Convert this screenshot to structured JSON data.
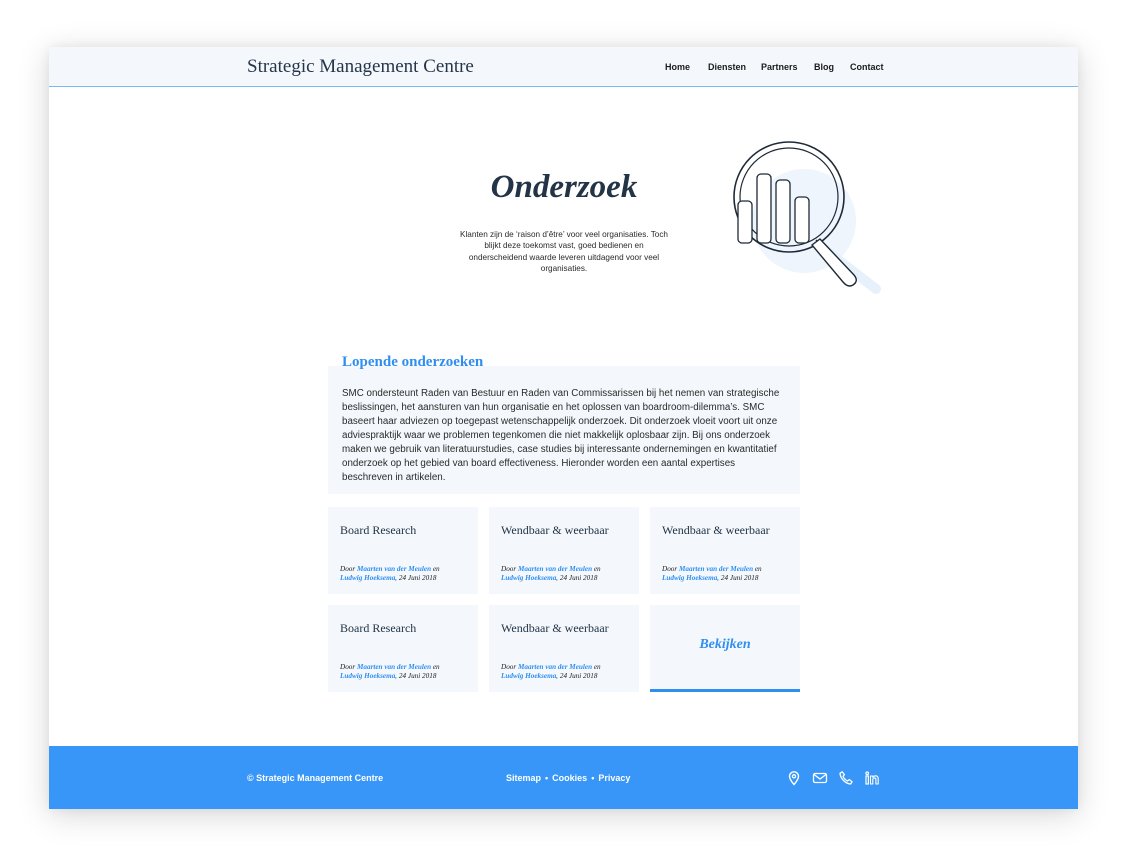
{
  "header": {
    "logo": "Strategic Management Centre",
    "nav": [
      "Home",
      "Diensten",
      "Partners",
      "Blog",
      "Contact"
    ]
  },
  "hero": {
    "title": "Onderzoek",
    "text": "Klanten zijn de ‘raison d’être’ voor veel organisaties. Toch blijkt deze toekomst vast, goed bedienen en onderscheidend waarde leveren uitdagend voor veel organisaties."
  },
  "intro": {
    "heading": "Lopende onderzoeken",
    "text": "SMC ondersteunt Raden van Bestuur en Raden van Commissarissen bij het nemen van strategische beslissingen, het aansturen van hun organisatie en het oplossen van boardroom-dilemma’s. SMC baseert haar adviezen op toegepast wetenschappelijk onderzoek. Dit onderzoek vloeit voort uit onze adviespraktijk waar we problemen tegenkomen die niet makkelijk oplosbaar zijn. Bij ons onderzoek maken we gebruik van literatuurstudies, case studies bij interessante ondernemingen en kwantitatief onderzoek op het gebied van board effectiveness. Hieronder worden een aantal expertises beschreven in artikelen."
  },
  "cards": [
    {
      "title": "Board Research",
      "by": "Door",
      "author1": "Maarten van der Meulen",
      "and": "en",
      "author2": "Ludwig Hoeksema,",
      "date": "24 Juni 2018"
    },
    {
      "title": "Wendbaar & weerbaar",
      "by": "Door",
      "author1": "Maarten van der Meulen",
      "and": "en",
      "author2": "Ludwig Hoeksema,",
      "date": "24 Juni 2018"
    },
    {
      "title": "Wendbaar & weerbaar",
      "by": "Door",
      "author1": "Maarten van der Meulen",
      "and": "en",
      "author2": "Ludwig Hoeksema,",
      "date": "24 Juni 2018"
    },
    {
      "title": "Board Research",
      "by": "Door",
      "author1": "Maarten van der Meulen",
      "and": "en",
      "author2": "Ludwig Hoeksema,",
      "date": "24 Juni 2018"
    },
    {
      "title": "Wendbaar & weerbaar",
      "by": "Door",
      "author1": "Maarten van der Meulen",
      "and": "en",
      "author2": "Ludwig Hoeksema,",
      "date": "24 Juni 2018"
    }
  ],
  "view_all": "Bekijken",
  "footer": {
    "copyright": "© Strategic Management Centre",
    "links": [
      "Sitemap",
      "Cookies",
      "Privacy"
    ],
    "separator": "•",
    "icons": [
      "location-icon",
      "mail-icon",
      "phone-icon",
      "linkedin-icon"
    ]
  },
  "colors": {
    "accent": "#2f8ef0",
    "footer": "#3796f8",
    "panel": "#f4f8fc",
    "heading": "#233446"
  }
}
